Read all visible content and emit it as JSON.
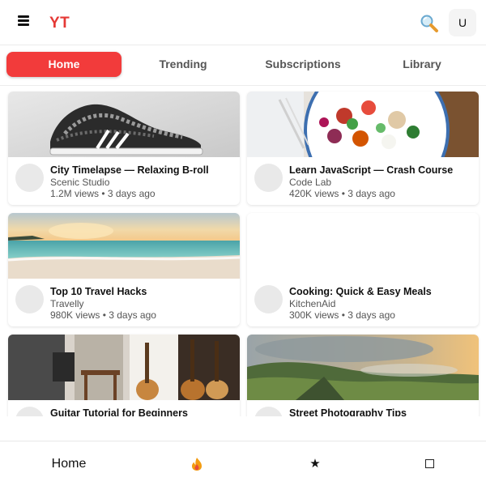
{
  "header": {
    "logo_text": "YT",
    "avatar_initial": "U",
    "brand_color": "#e53935",
    "icons": [
      "menu-icon",
      "search-icon"
    ]
  },
  "tabs": [
    {
      "label": "Home",
      "active": true
    },
    {
      "label": "Trending",
      "active": false
    },
    {
      "label": "Subscriptions",
      "active": false
    },
    {
      "label": "Library",
      "active": false
    }
  ],
  "videos": [
    {
      "title": "City Timelapse — Relaxing B-roll",
      "channel": "Scenic Studio",
      "stats": "1.2M views • 3 days ago",
      "thumbnail": "sneaker"
    },
    {
      "title": "Learn JavaScript — Crash Course",
      "channel": "Code Lab",
      "stats": "420K views • 3 days ago",
      "thumbnail": "salad-bowl"
    },
    {
      "title": "Top 10 Travel Hacks",
      "channel": "Travelly",
      "stats": "980K views • 3 days ago",
      "thumbnail": "beach-sunset"
    },
    {
      "title": "Cooking: Quick & Easy Meals",
      "channel": "KitchenAid",
      "stats": "300K views • 3 days ago",
      "thumbnail": "blank"
    },
    {
      "title": "Guitar Tutorial for Beginners",
      "channel": "",
      "stats": "",
      "thumbnail": "guitar-studio"
    },
    {
      "title": "Street Photography Tips",
      "channel": "",
      "stats": "",
      "thumbnail": "mountain-valley"
    }
  ],
  "bottom_nav": {
    "home_label": "Home",
    "icons": [
      "flame-icon",
      "star-icon",
      "square-icon"
    ],
    "star_glyph": "★"
  },
  "colors": {
    "accent": "#f23b3b",
    "muted_text": "#555555"
  }
}
